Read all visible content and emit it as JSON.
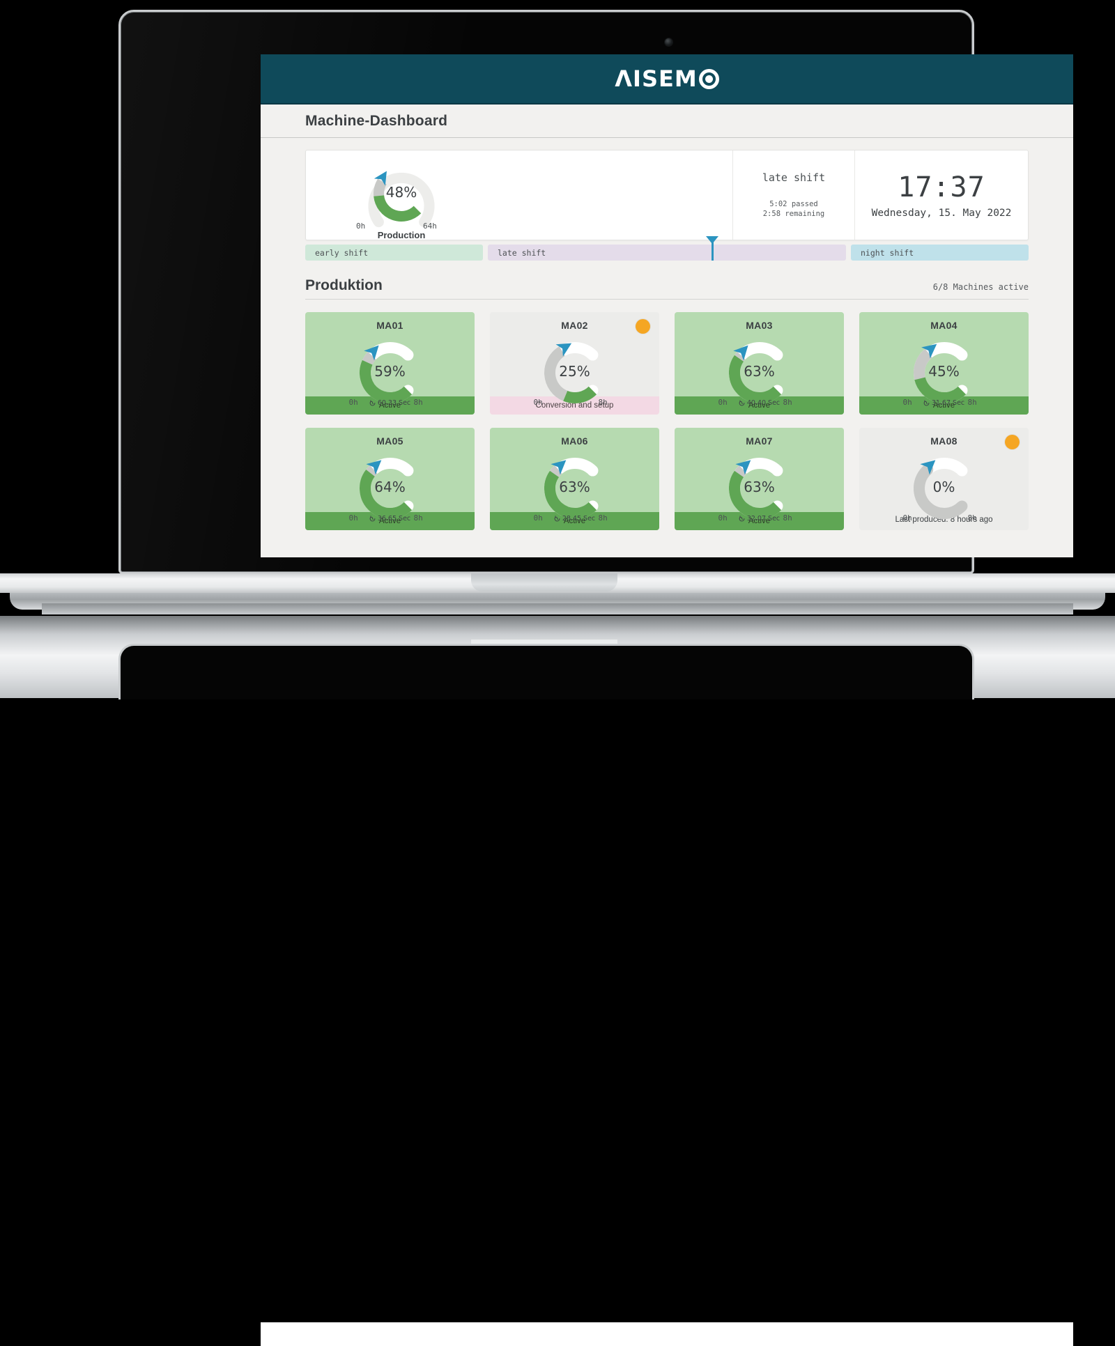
{
  "brand": {
    "logo_text": "ΛISEM",
    "logo_icon": "circle-dot-icon"
  },
  "page": {
    "title": "Machine-Dashboard"
  },
  "summary": {
    "gauge": {
      "value_label": "48%",
      "min_label": "0h",
      "max_label": "64h",
      "caption": "Production",
      "percent": 48,
      "marker_percent": 62,
      "gray_to_percent": 62
    },
    "shift": {
      "name": "late shift",
      "passed": "5:02 passed",
      "remaining": "2:58 remaining"
    },
    "clock": {
      "time": "17:37",
      "date": "Wednesday, 15. May 2022"
    }
  },
  "shift_bars": [
    {
      "label": "early shift",
      "color": "#cfe8d9"
    },
    {
      "label": "late shift",
      "color": "#e4dcea"
    },
    {
      "label": "night shift",
      "color": "#bfe1ea"
    }
  ],
  "production": {
    "heading": "Produktion",
    "machines_active": "6/8 Machines active"
  },
  "machines": [
    {
      "name": "MA01",
      "percent": 59,
      "value_label": "59%",
      "min_label": "0h",
      "max_label": "8h",
      "cycle": "60,33 Sec",
      "status": "Active",
      "state": "active",
      "badge": false,
      "marker_percent": 66,
      "gray_to_percent": 66
    },
    {
      "name": "MA02",
      "percent": 25,
      "value_label": "25%",
      "min_label": "0h",
      "max_label": "8h",
      "cycle": "",
      "status": "Conversion and setup",
      "state": "setup",
      "badge": true,
      "marker_percent": 72,
      "gray_to_percent": 72
    },
    {
      "name": "MA03",
      "percent": 63,
      "value_label": "63%",
      "min_label": "0h",
      "max_label": "8h",
      "cycle": "40,40 Sec",
      "status": "Active",
      "state": "active",
      "badge": false,
      "marker_percent": 66,
      "gray_to_percent": 66
    },
    {
      "name": "MA04",
      "percent": 45,
      "value_label": "45%",
      "min_label": "0h",
      "max_label": "8h",
      "cycle": "31,67 Sec",
      "status": "Active",
      "state": "active",
      "badge": false,
      "marker_percent": 69,
      "gray_to_percent": 69
    },
    {
      "name": "MA05",
      "percent": 64,
      "value_label": "64%",
      "min_label": "0h",
      "max_label": "8h",
      "cycle": "36,65 Sec",
      "status": "Active",
      "state": "active",
      "badge": false,
      "marker_percent": 68,
      "gray_to_percent": 68
    },
    {
      "name": "MA06",
      "percent": 63,
      "value_label": "63%",
      "min_label": "0h",
      "max_label": "8h",
      "cycle": "28,45 Sec",
      "status": "Active",
      "state": "active",
      "badge": false,
      "marker_percent": 68,
      "gray_to_percent": 68
    },
    {
      "name": "MA07",
      "percent": 63,
      "value_label": "63%",
      "min_label": "0h",
      "max_label": "8h",
      "cycle": "32,07 Sec",
      "status": "Active",
      "state": "active",
      "badge": false,
      "marker_percent": 68,
      "gray_to_percent": 68
    },
    {
      "name": "MA08",
      "percent": 0,
      "value_label": "0%",
      "min_label": "0h",
      "max_label": "8h",
      "cycle": "",
      "status": "Last produced: 8 hours ago",
      "state": "idle",
      "badge": true,
      "marker_percent": 68,
      "gray_to_percent": 68
    }
  ],
  "colors": {
    "header": "#0f4a5a",
    "gauge_green": "#5fa654",
    "gauge_gray": "#c8c9c7",
    "gauge_track": "#ededeb",
    "marker_blue": "#2b94c0",
    "badge_orange": "#f5a623",
    "card_active": "#b6dab0",
    "card_idle": "#ececea",
    "footer_active": "#5fa654",
    "footer_setup": "#f3d9e4"
  }
}
